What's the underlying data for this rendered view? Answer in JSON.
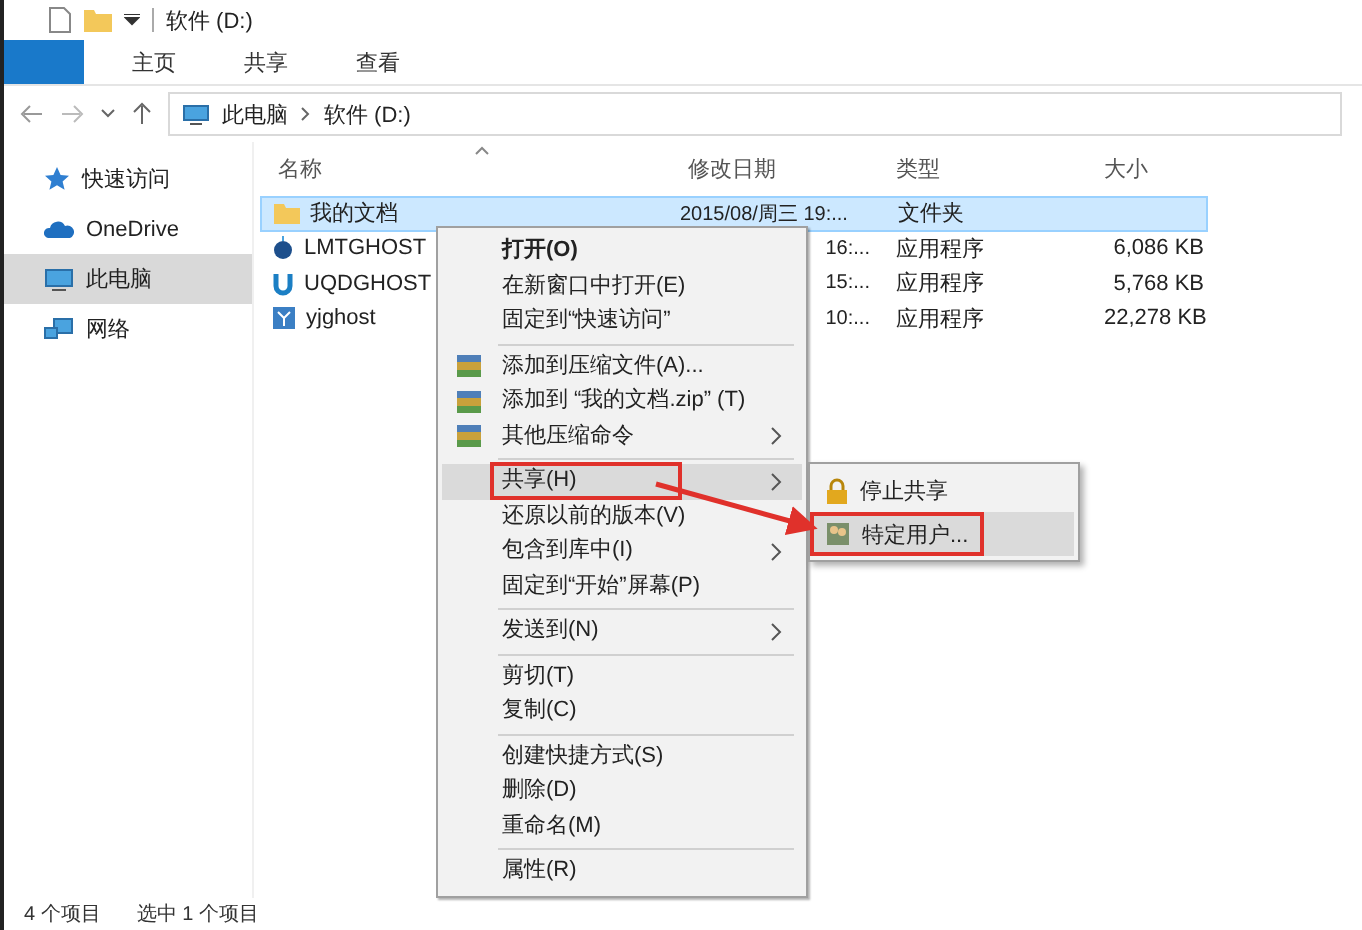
{
  "window": {
    "title": "软件 (D:)"
  },
  "ribbon": {
    "tabs": [
      {
        "label": "主页",
        "selected": false
      },
      {
        "label": "共享",
        "selected": false
      },
      {
        "label": "查看",
        "selected": false
      }
    ]
  },
  "address": {
    "path": [
      "此电脑",
      "软件 (D:)"
    ]
  },
  "sidebar": {
    "items": [
      {
        "label": "快速访问",
        "kind": "star",
        "selected": false
      },
      {
        "label": "OneDrive",
        "kind": "cloud",
        "selected": false
      },
      {
        "label": "此电脑",
        "kind": "pc",
        "selected": true
      },
      {
        "label": "网络",
        "kind": "network",
        "selected": false
      }
    ]
  },
  "table": {
    "columns": [
      "名称",
      "修改日期",
      "类型",
      "大小"
    ],
    "rows": [
      {
        "name": "我的文档",
        "kind": "folder",
        "date": "2015/08/周三 19:...",
        "type": "文件夹",
        "size": "",
        "selected": true
      },
      {
        "name": "LMTGHOST",
        "kind": "ball",
        "date": "16:...",
        "type": "应用程序",
        "size": "6,086 KB",
        "selected": false
      },
      {
        "name": "UQDGHOST",
        "kind": "u",
        "date": "15:...",
        "type": "应用程序",
        "size": "5,768 KB",
        "selected": false
      },
      {
        "name": "yjghost",
        "kind": "y",
        "date": "10:...",
        "type": "应用程序",
        "size": "22,278 KB",
        "selected": false
      }
    ]
  },
  "context_menu": {
    "items": [
      {
        "kind": "plain",
        "label": "打开(O)",
        "bold": true,
        "selected": false,
        "framed": false
      },
      {
        "kind": "plain",
        "label": "在新窗口中打开(E)",
        "selected": false,
        "framed": false
      },
      {
        "kind": "plain",
        "label": "固定到“快速访问”",
        "selected": false,
        "framed": false
      },
      {
        "kind": "separator"
      },
      {
        "kind": "archive",
        "label": "添加到压缩文件(A)...",
        "selected": false,
        "framed": false
      },
      {
        "kind": "archive",
        "label": "添加到 “我的文档.zip” (T)",
        "selected": false,
        "framed": false
      },
      {
        "kind": "archive",
        "label": "其他压缩命令",
        "submenu": true,
        "selected": false,
        "framed": false
      },
      {
        "kind": "separator"
      },
      {
        "kind": "plain",
        "label": "共享(H)",
        "submenu": true,
        "selected": true,
        "framed": true
      },
      {
        "kind": "plain",
        "label": "还原以前的版本(V)",
        "selected": false,
        "framed": false
      },
      {
        "kind": "plain",
        "label": "包含到库中(I)",
        "submenu": true,
        "selected": false,
        "framed": false
      },
      {
        "kind": "plain",
        "label": "固定到“开始”屏幕(P)",
        "selected": false,
        "framed": false
      },
      {
        "kind": "separator"
      },
      {
        "kind": "plain",
        "label": "发送到(N)",
        "submenu": true,
        "selected": false,
        "framed": false
      },
      {
        "kind": "separator"
      },
      {
        "kind": "plain",
        "label": "剪切(T)",
        "selected": false,
        "framed": false
      },
      {
        "kind": "plain",
        "label": "复制(C)",
        "selected": false,
        "framed": false
      },
      {
        "kind": "separator"
      },
      {
        "kind": "plain",
        "label": "创建快捷方式(S)",
        "selected": false,
        "framed": false
      },
      {
        "kind": "plain",
        "label": "删除(D)",
        "selected": false,
        "framed": false
      },
      {
        "kind": "plain",
        "label": "重命名(M)",
        "selected": false,
        "framed": false
      },
      {
        "kind": "separator"
      },
      {
        "kind": "plain",
        "label": "属性(R)",
        "selected": false,
        "framed": false
      }
    ]
  },
  "share_submenu": {
    "items": [
      {
        "label": "停止共享",
        "kind": "lock",
        "selected": false,
        "framed": false
      },
      {
        "label": "特定用户...",
        "kind": "users",
        "selected": true,
        "framed": true
      }
    ]
  },
  "status_bar": {
    "items": [
      "4 个项目",
      "选中 1 个项目"
    ]
  }
}
